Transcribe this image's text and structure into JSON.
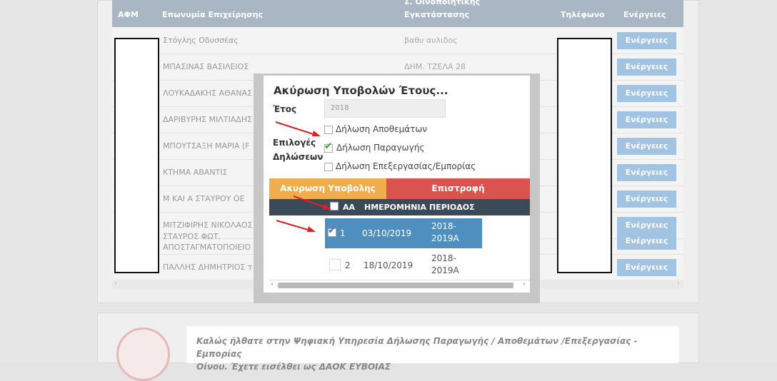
{
  "table": {
    "headers": {
      "afm": "ΑΦΜ",
      "company": "Επωνυμία Επιχείρησης",
      "installation_line1": "Σ. Οινοποιητικής",
      "installation_line2": "Εγκατάστασης",
      "phone": "Τηλέφωνο",
      "actions": "Ενέργειες"
    },
    "rows": [
      {
        "name": "Στόγλης Οδυσσέας",
        "address": "βαθυ αυλιδος",
        "action": "Ενέργειες"
      },
      {
        "name": "ΜΠΑΣΙΝΑΣ ΒΑΣΙΛΕΙΟΣ",
        "address": "ΔΗΜ. ΤΖΕΛΑ 28",
        "action": "Ενέργειες"
      },
      {
        "name": "ΛΟΥΚΑΔΑΚΗΣ ΑΘΑΝΑΣ",
        "address": "",
        "action": "Ενέργειες"
      },
      {
        "name": "ΔΑΡΙΒΥΡΗΣ ΜΙΛΤΙΑΔΗΣ",
        "address": "",
        "action": "Ενέργειες"
      },
      {
        "name": "ΜΠΟΥΤΣΑΞΗ ΜΑΡΙΑ (F",
        "address": "",
        "action": "Ενέργειες"
      },
      {
        "name": "ΚΤΗΜΑ ΑΒΑΝΤΙΣ",
        "address": "",
        "action": "Ενέργειες"
      },
      {
        "name": "Μ ΚΑΙ Α ΣΤΑΥΡΟΥ ΟΕ",
        "address": "",
        "action": "Ενέργειες"
      },
      {
        "name": "ΜΙΤΖΙΦΙΡΗΣ ΝΙΚΟΛΑΟΣ",
        "address": "",
        "action": "Ενέργειες"
      },
      {
        "name": "ΣΤΑΥΡΟΣ ΦΩΤ. ΑΠΟΣΤΑΓΜΑΤΟΠΟΙΕΙΟ",
        "address": "",
        "action": "Ενέργειες"
      },
      {
        "name": "ΠΑΛΛΗΣ ΔΗΜΗΤΡΙΟΣ τ",
        "address": "",
        "action": "Ενέργειες"
      }
    ]
  },
  "modal": {
    "title": "Ακύρωση Υποβολών Έτους...",
    "year_label": "Έτος",
    "year_value": "2018",
    "options_label": "Επιλογές Δηλώσεων",
    "options": [
      {
        "label": "Δήλωση Αποθεμάτων",
        "checked": false
      },
      {
        "label": "Δήλωση Παραγωγής",
        "checked": true
      },
      {
        "label": "Δήλωση Επεξεργασίας/Εμπορίας",
        "checked": false
      }
    ],
    "cancel_button": "Ακυρωση Υποβολης",
    "return_button": "Επιστροφή",
    "inner_table": {
      "headers": {
        "aa": "ΑΑ",
        "date": "ΗΜΕΡΟΜΗΝΙΑ",
        "period": "ΠΕΡΙΟΔΟΣ"
      },
      "rows": [
        {
          "aa": "1",
          "date": "03/10/2019",
          "period_line1": "2018-",
          "period_line2": "2019A",
          "selected": true
        },
        {
          "aa": "2",
          "date": "18/10/2019",
          "period_line1": "2018-",
          "period_line2": "2019A",
          "selected": false
        }
      ]
    }
  },
  "welcome": {
    "line1": "Καλώς ήλθατε στην Ψηφιακή Υπηρεσία Δήλωσης Παραγωγής / Αποθεμάτων /Επεξεργασίας - Εμπορίας",
    "line2": "Οίνου. Έχετε εισέλθει ως ΔΑΟΚ ΕΥΒΟΙΑΣ"
  },
  "colors": {
    "header": "#a9b7c5",
    "action": "#a3c3e3",
    "cancel": "#f0ad4e",
    "return": "#d9534f",
    "selected_row": "#4f8fbf",
    "annotation_arrow": "#e02020"
  }
}
